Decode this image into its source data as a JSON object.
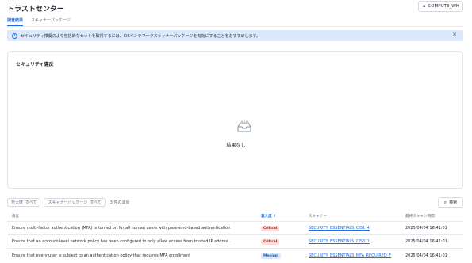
{
  "header": {
    "title": "トラストセンター",
    "warehouse_label": "COMPUTE_WH"
  },
  "tabs": [
    {
      "label": "調査結果",
      "active": true
    },
    {
      "label": "スキャナーパッケージ",
      "active": false
    }
  ],
  "banner": {
    "text": "セキュリティ推奨のより包括的なセットを取得するには、CISベンチマークスキャナーパッケージを有効にすることをおすすめします。"
  },
  "card": {
    "title": "セキュリティ違反",
    "empty_text": "結果なし"
  },
  "filters": {
    "severity_label": "重大度",
    "severity_value": "すべて",
    "package_label": "スキャナーパッケージ",
    "package_value": "すべて",
    "count_text": "3 件の違反",
    "search_label": "検索"
  },
  "table": {
    "columns": [
      "違反",
      "重大度",
      "スキャナー",
      "最終スキャン時間"
    ],
    "rows": [
      {
        "violation": "Ensure multi-factor authentication (MFA) is turned on for all human users with password-based authentication",
        "severity": "Critical",
        "scanner": "SECURITY_ESSENTIALS_CIS1_4",
        "last_scan": "2025/04/04 16:41:01"
      },
      {
        "violation": "Ensure that an account-level network policy has been configured to only allow access from trusted IP addres...",
        "severity": "Critical",
        "scanner": "SECURITY_ESSENTIALS_CIS3_1",
        "last_scan": "2025/04/04 16:41:01"
      },
      {
        "violation": "Ensure that every user is subject to an authentication policy that requires MFA enrollment",
        "severity": "Medium",
        "scanner": "SECURITY_ESSENTIALS_MFA_REQUIRED_F",
        "last_scan": "2025/04/04 16:41:01"
      }
    ]
  },
  "icons": {
    "warehouse": "warehouse-icon",
    "info": "info-icon",
    "close": "close-icon",
    "empty": "empty-inbox-icon",
    "search": "search-icon",
    "sort": "sort-ascending-icon"
  },
  "colors": {
    "accent": "#1a6ce7",
    "banner_bg": "#dce9fd",
    "critical_bg": "#fcdcdc",
    "critical_text": "#b21b1b",
    "medium_bg": "#dce9fd",
    "medium_text": "#1458c4"
  }
}
